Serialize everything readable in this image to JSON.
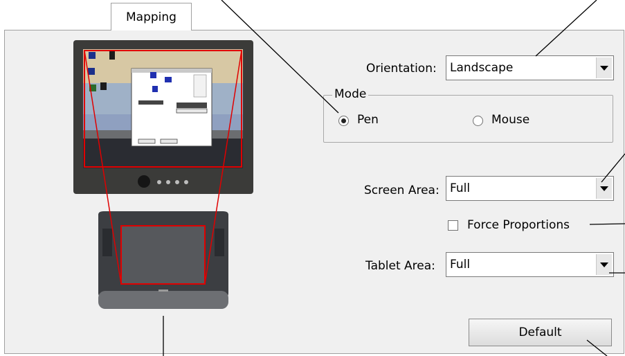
{
  "tab": {
    "label": "Mapping"
  },
  "orientation": {
    "label": "Orientation:",
    "value": "Landscape"
  },
  "mode": {
    "legend": "Mode",
    "options": [
      {
        "label": "Pen",
        "selected": true
      },
      {
        "label": "Mouse",
        "selected": false
      }
    ]
  },
  "screen_area": {
    "label": "Screen Area:",
    "value": "Full"
  },
  "force_proportions": {
    "label": "Force Proportions",
    "checked": false
  },
  "tablet_area": {
    "label": "Tablet Area:",
    "value": "Full"
  },
  "default_button": {
    "label": "Default"
  },
  "icons": [
    "radio-selected",
    "radio-unselected",
    "checkbox-unchecked",
    "dropdown-arrow"
  ],
  "colors": {
    "panel_bg": "#f0f0f0",
    "mapping_outline": "#e00000",
    "monitor_bezel": "#3a3a38",
    "tablet_body": "#3c3e42"
  }
}
